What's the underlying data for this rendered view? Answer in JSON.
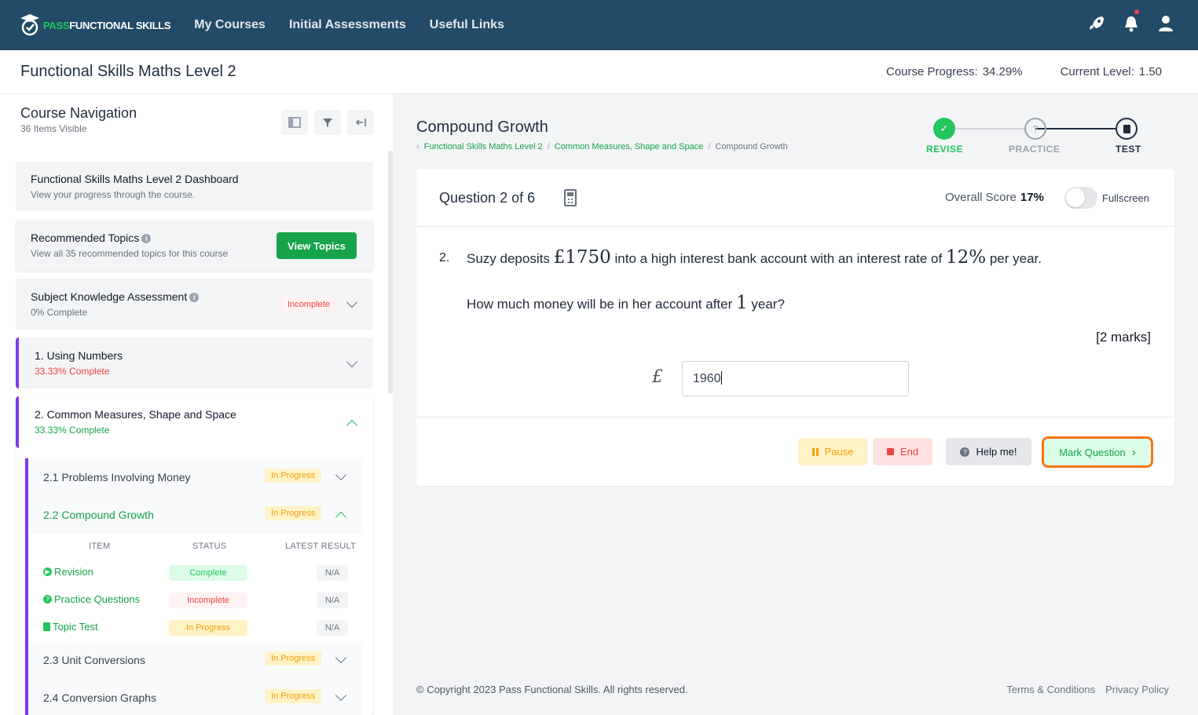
{
  "brand": {
    "pass": "PASS",
    "rest": "FUNCTIONAL SKILLS",
    "accent": "#22c55e",
    "nav_bg": "#234a66"
  },
  "nav": {
    "links": [
      "My Courses",
      "Initial Assessments",
      "Useful Links"
    ],
    "icons": [
      "rocket-icon",
      "bell-icon",
      "user-icon"
    ]
  },
  "course": {
    "title": "Functional Skills Maths Level 2",
    "progress_label": "Course Progress:",
    "progress_value": "34.29%",
    "level_label": "Current Level:",
    "level_value": "1.50"
  },
  "sidebar": {
    "title": "Course Navigation",
    "subtitle": "36 Items Visible",
    "dashboard": {
      "title": "Functional Skills Maths Level 2 Dashboard",
      "subtitle": "View your progress through the course."
    },
    "recommended": {
      "title": "Recommended Topics",
      "subtitle": "View all 35 recommended topics for this course",
      "button": "View Topics"
    },
    "ska": {
      "title": "Subject Knowledge Assessment",
      "subtitle": "0% Complete",
      "status": "Incomplete"
    },
    "section1": {
      "title": "1. Using Numbers",
      "subtitle": "33.33% Complete"
    },
    "section2": {
      "title": "2. Common Measures, Shape and Space",
      "subtitle": "33.33% Complete"
    },
    "topics": [
      {
        "label": "2.1 Problems Involving Money",
        "status": "In Progress"
      },
      {
        "label": "2.2 Compound Growth",
        "status": "In Progress"
      },
      {
        "label": "2.3 Unit Conversions",
        "status": "In Progress"
      },
      {
        "label": "2.4 Conversion Graphs",
        "status": "In Progress"
      }
    ],
    "table": {
      "headers": [
        "ITEM",
        "STATUS",
        "LATEST RESULT"
      ],
      "rows": [
        {
          "item": "Revision",
          "status": "Complete",
          "result": "N/A"
        },
        {
          "item": "Practice Questions",
          "status": "Incomplete",
          "result": "N/A"
        },
        {
          "item": "Topic Test",
          "status": "In Progress",
          "result": "N/A"
        }
      ]
    }
  },
  "main": {
    "title": "Compound Growth",
    "breadcrumb": [
      "Functional Skills Maths Level 2",
      "Common Measures, Shape and Space",
      "Compound Growth"
    ],
    "steps": [
      "REVISE",
      "PRACTICE",
      "TEST"
    ],
    "question": {
      "label": "Question",
      "number": "2",
      "of_label": "of",
      "total": "6",
      "score_label": "Overall Score",
      "score_value": "17%",
      "fullscreen_label": "Fullscreen",
      "index": "2.",
      "text_a": "Suzy deposits",
      "amount": "£1750",
      "text_b": "into a high interest bank account with an interest rate of",
      "rate": "12%",
      "text_c": "per year.",
      "text_d": "How much money will be in her account after",
      "years": "1",
      "text_e": "year?",
      "marks": "[2 marks]",
      "currency": "£",
      "answer_value": "1960"
    },
    "buttons": {
      "pause": "Pause",
      "end": "End",
      "help": "Help me!",
      "mark": "Mark Question"
    }
  },
  "footer": {
    "copyright": "© Copyright 2023 Pass Functional Skills. All rights reserved.",
    "links": [
      "Terms & Conditions",
      "Privacy Policy"
    ]
  }
}
